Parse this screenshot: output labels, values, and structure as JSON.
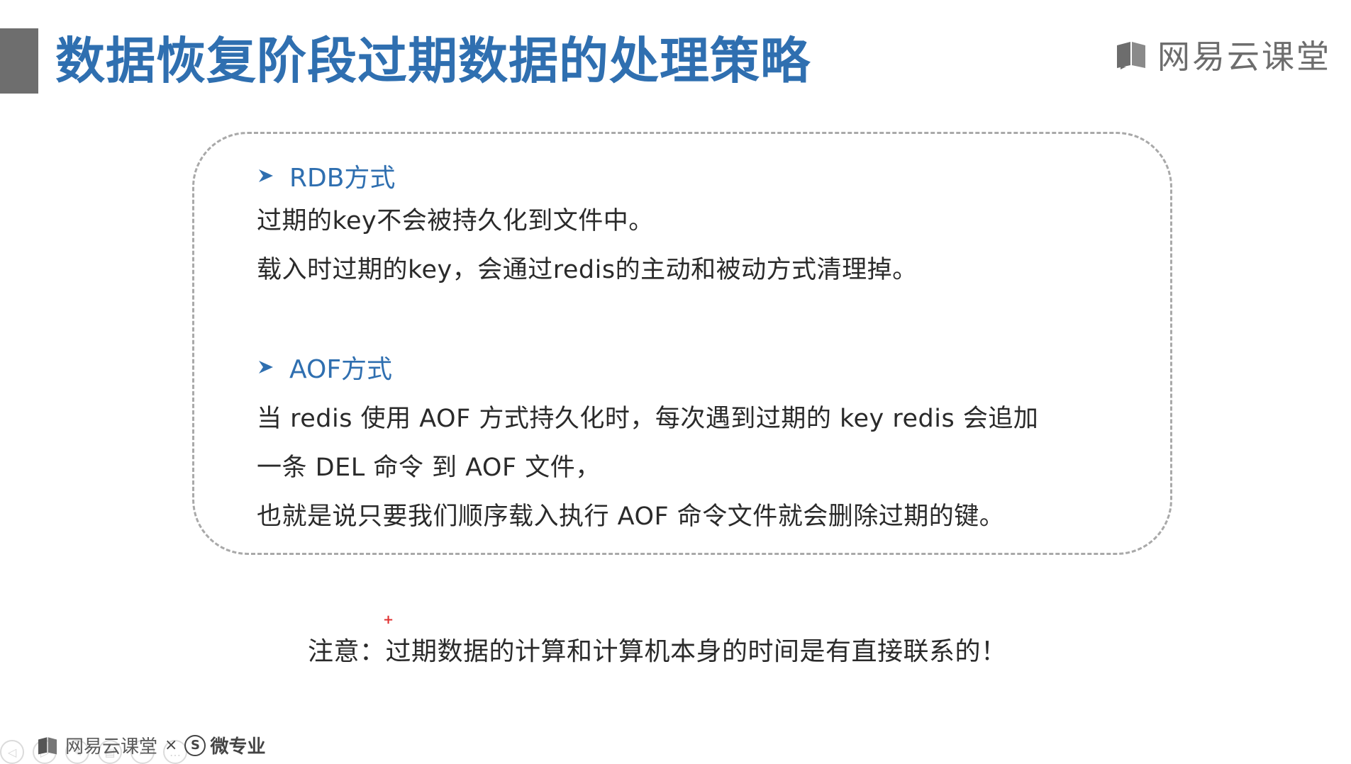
{
  "slide": {
    "title": "数据恢复阶段过期数据的处理策略",
    "brand": "网易云课堂",
    "accent_color": "#2f6fb0",
    "sections": [
      {
        "heading": "RDB方式",
        "lines": [
          "过期的key不会被持久化到文件中。",
          "载入时过期的key，会通过redis的主动和被动方式清理掉。"
        ]
      },
      {
        "heading": "AOF方式",
        "lines": [
          "当 redis 使用 AOF 方式持久化时，每次遇到过期的 key redis 会追加",
          "一条 DEL 命令 到 AOF 文件，",
          "也就是说只要我们顺序载入执行 AOF 命令文件就会删除过期的键。"
        ]
      }
    ],
    "note": "注意：过期数据的计算和计算机本身的时间是有直接联系的！"
  },
  "footer": {
    "brand": "网易云课堂",
    "separator": "×",
    "partner_mark": "S",
    "partner": "微专业"
  },
  "player_controls": [
    {
      "icon": "prev-icon",
      "glyph": "◁"
    },
    {
      "icon": "next-icon",
      "glyph": "▷"
    },
    {
      "icon": "pen-icon",
      "glyph": "✎"
    },
    {
      "icon": "slides-icon",
      "glyph": "▤"
    },
    {
      "icon": "zoom-icon",
      "glyph": "⌕"
    },
    {
      "icon": "more-icon",
      "glyph": "…"
    }
  ]
}
